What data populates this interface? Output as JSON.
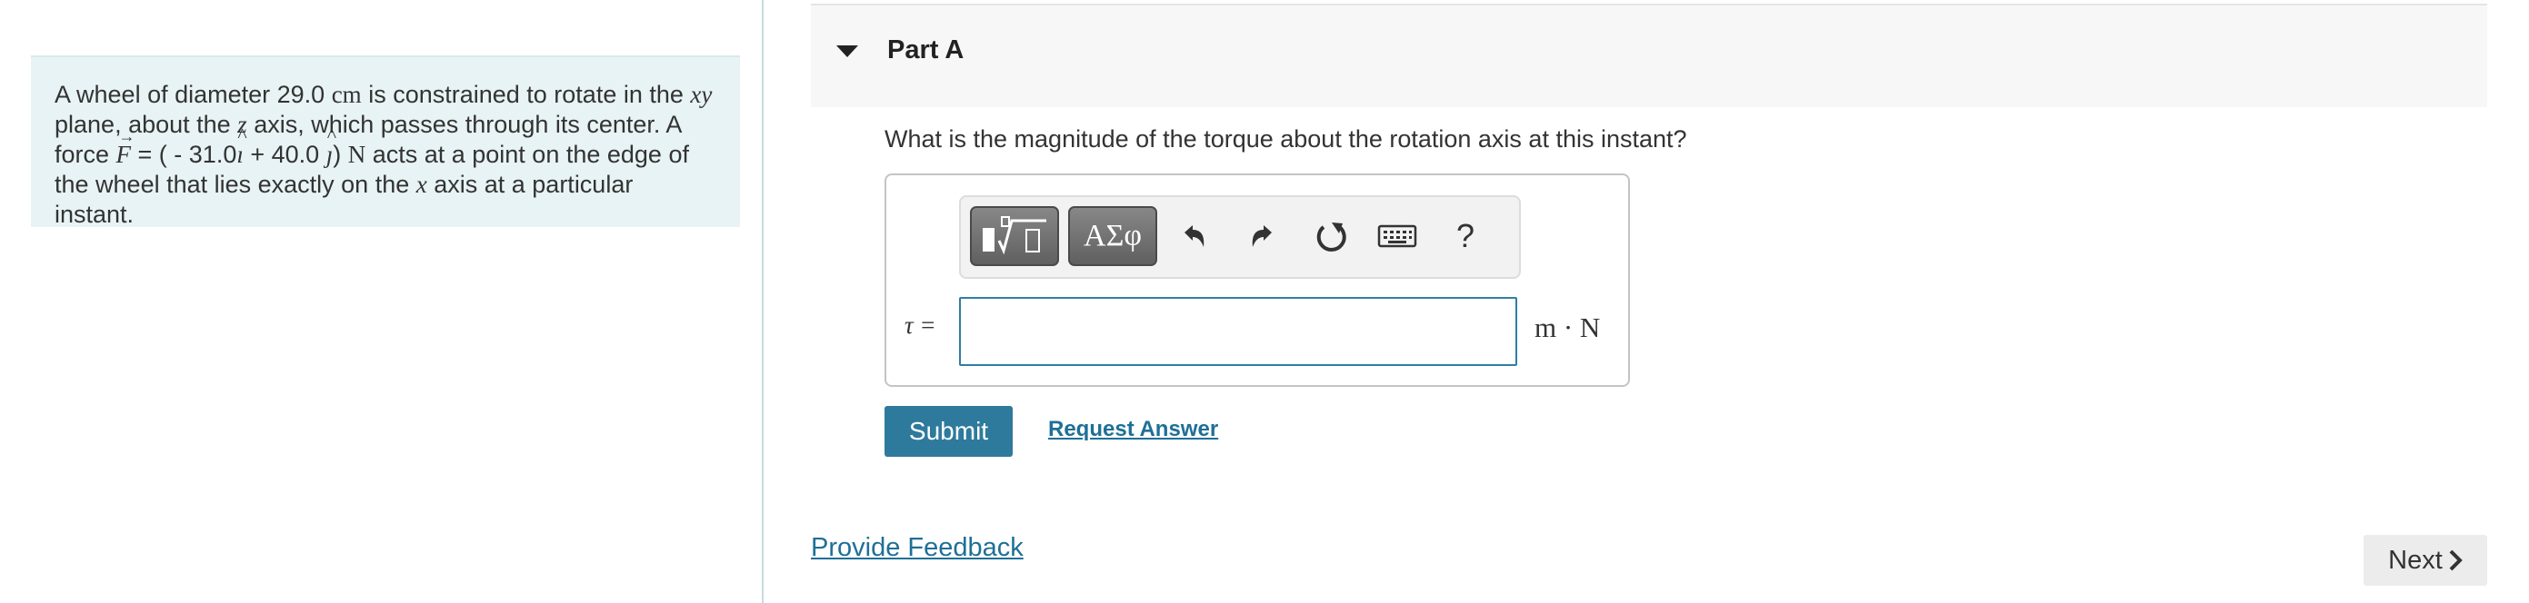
{
  "problem": {
    "line1_a": "A wheel of diameter 29.0 ",
    "line1_unit": "cm",
    "line1_b": " is constrained to rotate in the ",
    "line1_var": "xy",
    "line2_a": "plane, about the ",
    "line2_var": "z",
    "line2_b": " axis, which passes through its center. A",
    "line3_a": "force ",
    "force_symbol": "F",
    "line3_eq": " = ( - 31.0",
    "i_hat": "ı",
    "line3_plus": " + 40.0 ",
    "j_hat": "ȷ",
    "line3_close": ") ",
    "force_unit": "N",
    "line3_b": " acts at a point on the edge of",
    "line4_a": "the wheel that lies exactly on the ",
    "line4_var": "x",
    "line4_b": " axis at a particular instant."
  },
  "part": {
    "title": "Part A"
  },
  "question": "What is the magnitude of the torque about the rotation axis at this instant?",
  "toolbar": {
    "templates_icon": "templates-icon",
    "symbols_label": "ΑΣφ",
    "undo_icon": "undo-icon",
    "redo_icon": "redo-icon",
    "reset_icon": "reset-icon",
    "keyboard_icon": "keyboard-icon",
    "help_label": "?"
  },
  "answer": {
    "label": "τ =",
    "value": "",
    "units": "m · N"
  },
  "actions": {
    "submit_label": "Submit",
    "request_answer_label": "Request Answer",
    "feedback_label": "Provide Feedback",
    "next_label": "Next"
  },
  "colors": {
    "accent": "#2e7a9c",
    "link": "#1f6f97",
    "problem_bg": "#e8f3f5"
  }
}
